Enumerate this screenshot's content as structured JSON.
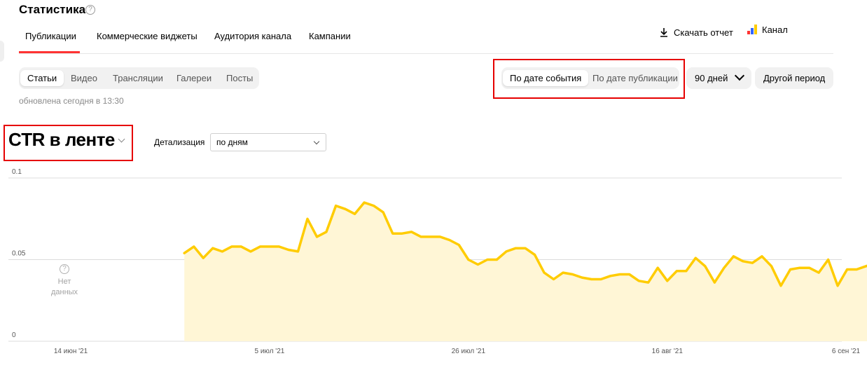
{
  "page": {
    "title": "Статистика",
    "help_icon": "?"
  },
  "tabs": [
    {
      "label": "Публикации",
      "active": true
    },
    {
      "label": "Коммерческие виджеты"
    },
    {
      "label": "Аудитория канала"
    },
    {
      "label": "Кампании"
    }
  ],
  "header_actions": {
    "download_label": "Скачать отчет",
    "channel_label": "Канал"
  },
  "content_types": [
    {
      "label": "Статьи",
      "active": true
    },
    {
      "label": "Видео"
    },
    {
      "label": "Трансляции"
    },
    {
      "label": "Галереи"
    },
    {
      "label": "Посты"
    }
  ],
  "updated_text": "обновлена сегодня в 13:30",
  "date_mode": [
    {
      "label": "По дате события",
      "active": true
    },
    {
      "label": "По дате публикации"
    }
  ],
  "period": {
    "selected": "90 дней",
    "other_label": "Другой период"
  },
  "metric": {
    "title": "CTR в ленте"
  },
  "detail": {
    "label": "Детализация",
    "selected": "по дням"
  },
  "no_data": {
    "icon": "?",
    "line1": "Нет",
    "line2": "данных"
  },
  "colors": {
    "accent": "#ff3333",
    "line": "#ffcc00",
    "fill": "#fff6d6",
    "highlight_box": "#e60000"
  },
  "chart_data": {
    "type": "area",
    "y_ticks": [
      "0.1",
      "0.05",
      "0"
    ],
    "ylim": [
      0,
      0.1
    ],
    "x_ticks": [
      "14 июн '21",
      "5 июл '21",
      "26 июл '21",
      "16 авг '21",
      "6 сен '21"
    ],
    "x_tick_index": [
      0,
      21,
      42,
      63,
      84
    ],
    "first_data_index": 12,
    "values": [
      0.054,
      0.058,
      0.051,
      0.057,
      0.055,
      0.058,
      0.058,
      0.055,
      0.058,
      0.058,
      0.058,
      0.056,
      0.055,
      0.075,
      0.064,
      0.067,
      0.083,
      0.081,
      0.078,
      0.085,
      0.083,
      0.079,
      0.066,
      0.066,
      0.067,
      0.064,
      0.064,
      0.064,
      0.062,
      0.059,
      0.05,
      0.047,
      0.05,
      0.05,
      0.055,
      0.057,
      0.057,
      0.053,
      0.042,
      0.038,
      0.042,
      0.041,
      0.039,
      0.038,
      0.038,
      0.04,
      0.041,
      0.041,
      0.037,
      0.036,
      0.045,
      0.037,
      0.043,
      0.043,
      0.051,
      0.046,
      0.036,
      0.045,
      0.052,
      0.049,
      0.048,
      0.052,
      0.046,
      0.034,
      0.044,
      0.045,
      0.045,
      0.042,
      0.05,
      0.034,
      0.044,
      0.044,
      0.046,
      0.048,
      0.046,
      0.048,
      0.044,
      0.038
    ]
  }
}
